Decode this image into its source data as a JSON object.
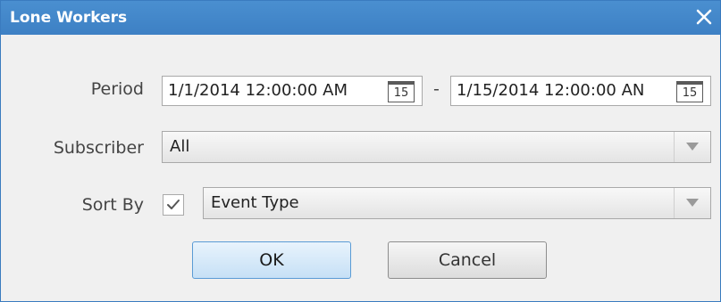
{
  "dialog": {
    "title": "Lone Workers"
  },
  "period": {
    "label": "Period",
    "from_value": "1/1/2014 12:00:00 AM",
    "separator": "-",
    "to_value": "1/15/2014 12:00:00 AN",
    "calendar_day": "15"
  },
  "subscriber": {
    "label": "Subscriber",
    "value": "All"
  },
  "sort_by": {
    "label": "Sort By",
    "checked": true,
    "value": "Event Type"
  },
  "buttons": {
    "ok": "OK",
    "cancel": "Cancel"
  },
  "colors": {
    "titlebar": "#3d80c4",
    "ok_border": "#5a9bd5"
  }
}
